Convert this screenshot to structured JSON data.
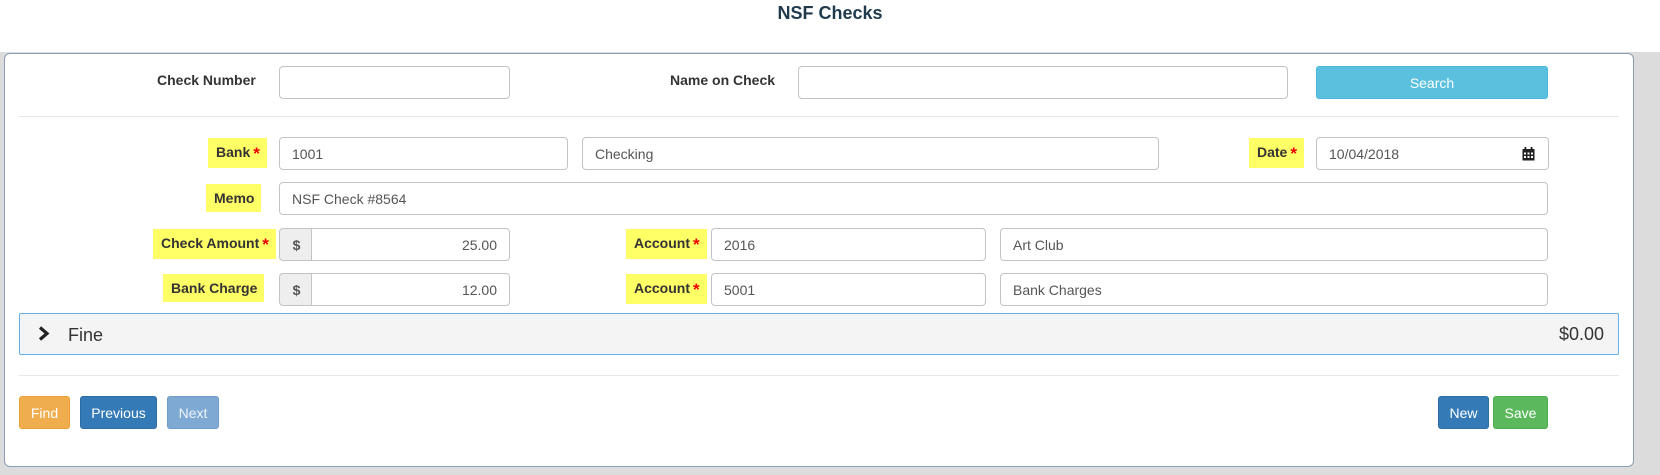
{
  "page": {
    "title": "NSF Checks"
  },
  "search": {
    "check_number_label": "Check Number",
    "check_number_value": "",
    "name_on_check_label": "Name on Check",
    "name_on_check_value": "",
    "search_button": "Search"
  },
  "form": {
    "bank_label": "Bank",
    "bank_code": "1001",
    "bank_name": "Checking",
    "date_label": "Date",
    "date_value": "10/04/2018",
    "memo_label": "Memo",
    "memo_value": "NSF Check #8564",
    "check_amount_label": "Check Amount",
    "check_amount_currency": "$",
    "check_amount_value": "25.00",
    "check_account_label": "Account",
    "check_account_code": "2016",
    "check_account_name": "Art Club",
    "bank_charge_label": "Bank Charge",
    "bank_charge_currency": "$",
    "bank_charge_value": "12.00",
    "charge_account_label": "Account",
    "charge_account_code": "5001",
    "charge_account_name": "Bank Charges",
    "required_marker": "*"
  },
  "fine": {
    "label": "Fine",
    "amount": "$0.00"
  },
  "actions": {
    "find": "Find",
    "previous": "Previous",
    "next": "Next",
    "new": "New",
    "save": "Save"
  },
  "colors": {
    "highlight": "#ffff66",
    "required": "#ee0000",
    "search": "#5bc0de",
    "find": "#f0ad4e",
    "primary": "#337ab7",
    "success": "#5cb85c"
  },
  "icons": {
    "calendar": "calendar-icon",
    "fine_toggle": "chevron-right-icon"
  }
}
